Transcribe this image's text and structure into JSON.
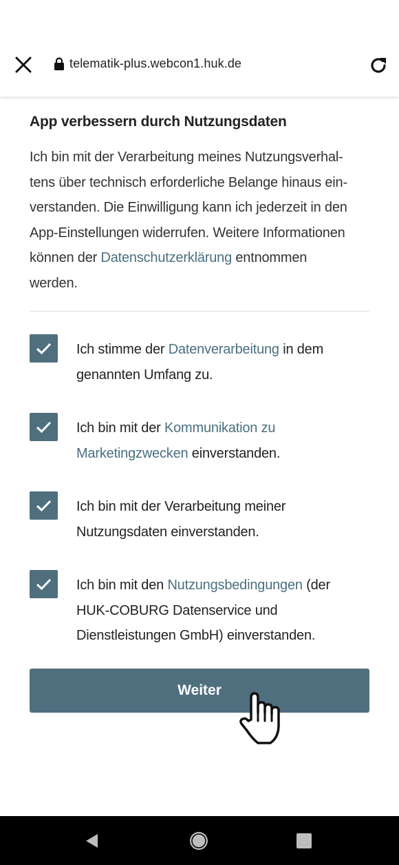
{
  "browser": {
    "url": "telematik-plus.webcon1.huk.de"
  },
  "section": {
    "title": "App verbessern durch Nutzungsdaten",
    "para_lines": [
      "Ich bin mit der Verarbeitung meines Nutzungsverhal-",
      "tens über technisch erforderliche Belange hinaus ein-",
      "verstanden. Die Einwilligung kann ich jederzeit in den",
      "App-Einstellungen widerrufen. Weitere Informationen"
    ],
    "para_prefix": "können der",
    "para_link": "Datenschutzerklärung",
    "para_suffix_1": "entnommen",
    "para_suffix_2": "werden."
  },
  "consents": [
    {
      "checked": true,
      "pre": "Ich stimme der ",
      "link": "Datenverarbeitung",
      "mid": " in dem",
      "line2": "genannten Umfang zu."
    },
    {
      "checked": true,
      "pre": "Ich bin mit der ",
      "link": "Kommunikation zu",
      "link2": "Marketingzwecken",
      "post2": " einverstanden."
    },
    {
      "checked": true,
      "line1": "Ich bin mit der Verarbeitung meiner",
      "line2": "Nutzungsdaten einverstanden."
    },
    {
      "checked": true,
      "pre": "Ich bin mit den ",
      "link": "Nutzungsbedingungen",
      "mid": " (der",
      "line2": "HUK-COBURG Datenservice und",
      "line3": "Dienstleistungen GmbH) einverstanden."
    }
  ],
  "buttons": {
    "continue": "Weiter"
  },
  "icons": {
    "close": "close-icon",
    "lock": "lock-icon",
    "reload": "reload-icon",
    "check": "checkmark-icon",
    "cursor": "hand-pointer-icon",
    "nav_back": "back-triangle-icon",
    "nav_home": "home-circle-icon",
    "nav_recent": "recents-square-icon"
  },
  "colors": {
    "accent": "#4f6f7e",
    "link": "#4a6f80",
    "navbar": "#000000"
  }
}
